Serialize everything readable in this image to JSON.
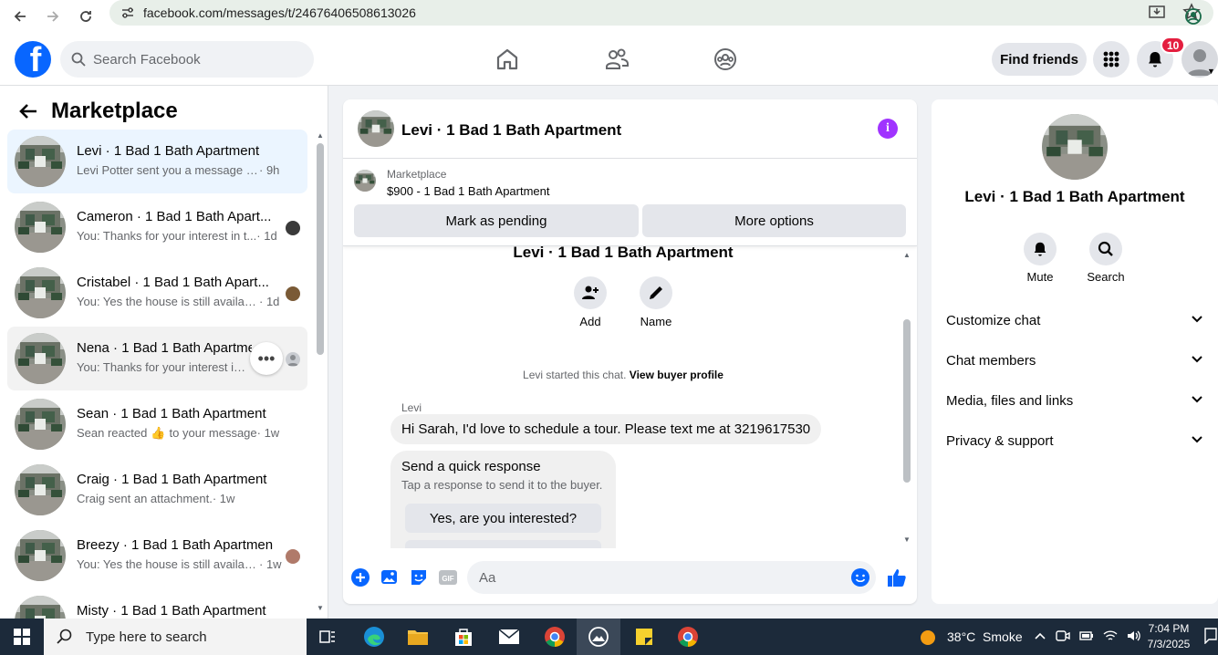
{
  "browser": {
    "url": "facebook.com/messages/t/24676406508613026"
  },
  "header": {
    "search_placeholder": "Search Facebook",
    "find_friends": "Find friends",
    "notification_count": "10"
  },
  "sidebar": {
    "title": "Marketplace",
    "conversations": [
      {
        "name": "Levi · 1 Bad 1 Bath Apartment",
        "preview": "Levi Potter sent you a message abo...",
        "time": "· 9h"
      },
      {
        "name": "Cameron · 1 Bad 1 Bath Apart...",
        "preview": "You: Thanks for your interest in t...",
        "time": "· 1d"
      },
      {
        "name": "Cristabel · 1 Bad 1 Bath Apart...",
        "preview": "You: Yes the house is still availab...",
        "time": "· 1d"
      },
      {
        "name": "Nena · 1 Bad 1 Bath Apartme",
        "preview": "You: Thanks for your interest in t...",
        "time": ""
      },
      {
        "name": "Sean · 1 Bad 1 Bath Apartment",
        "preview": "Sean reacted",
        "preview_after": "to your message",
        "time": "· 1w"
      },
      {
        "name": "Craig · 1 Bad 1 Bath Apartment",
        "preview": "Craig sent an attachment.",
        "time": "· 1w"
      },
      {
        "name": "Breezy · 1 Bad 1 Bath Apartment",
        "preview": "You: Yes the house is still availab...",
        "time": "· 1w"
      },
      {
        "name": "Misty · 1 Bad 1 Bath Apartment",
        "preview": "",
        "time": ""
      }
    ]
  },
  "chat": {
    "title": "Levi · 1 Bad 1 Bath Apartment",
    "listing_label": "Marketplace",
    "listing_price": "$900 - 1 Bad 1 Bath Apartment",
    "mark_pending": "Mark as pending",
    "more_options": "More options",
    "thread_name": "Levi · 1 Bad 1 Bath Apartment",
    "add_label": "Add",
    "name_label": "Name",
    "started_note": "Levi started this chat.",
    "view_profile": "View buyer profile",
    "sender": "Levi",
    "message": "Hi Sarah, I'd love to schedule a tour. Please text me at 3219617530",
    "quick_title": "Send a quick response",
    "quick_sub": "Tap a response to send it to the buyer.",
    "quick_option": "Yes, are you interested?",
    "composer_placeholder": "Aa"
  },
  "info": {
    "title": "Levi · 1 Bad 1 Bath Apartment",
    "mute": "Mute",
    "search": "Search",
    "sections": [
      "Customize chat",
      "Chat members",
      "Media, files and links",
      "Privacy & support"
    ]
  },
  "taskbar": {
    "search_placeholder": "Type here to search",
    "weather": "38°C  Smoke",
    "time": "7:04 PM",
    "date": "7/3/2025"
  },
  "colors": {
    "fb_blue": "#0866ff",
    "messenger_purple": "#a033ff",
    "active_convo": "#ebf5ff",
    "badge_red": "#e41e3f"
  }
}
